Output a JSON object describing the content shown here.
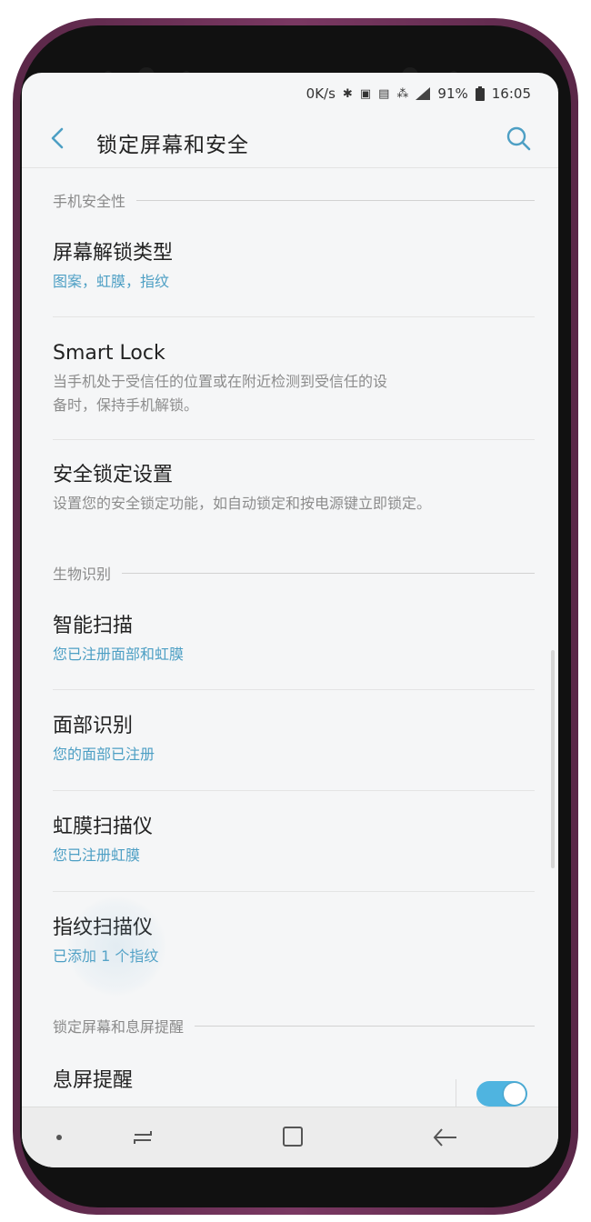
{
  "status_bar": {
    "speed": "0K/s",
    "icons": [
      "bluetooth-icon",
      "nfc-icon",
      "vibrate-icon",
      "network-icon",
      "signal-icon"
    ],
    "battery": "91%",
    "time": "16:05"
  },
  "header": {
    "title": "锁定屏幕和安全",
    "back_icon": "chevron-left-icon",
    "search_icon": "search-icon"
  },
  "sections": [
    {
      "header": "手机安全性",
      "items": [
        {
          "title": "屏幕解锁类型",
          "subtitle": "图案，虹膜，指纹"
        },
        {
          "title": "Smart Lock",
          "desc_line1": "当手机处于受信任的位置或在附近检测到受信任的设",
          "desc_line2": "备时，保持手机解锁。"
        },
        {
          "title": "安全锁定设置",
          "desc": "设置您的安全锁定功能，如自动锁定和按电源键立即锁定。"
        }
      ]
    },
    {
      "header": "生物识别",
      "items": [
        {
          "title": "智能扫描",
          "subtitle": "您已注册面部和虹膜"
        },
        {
          "title": "面部识别",
          "subtitle": "您的面部已注册"
        },
        {
          "title": "虹膜扫描仪",
          "subtitle": "您已注册虹膜"
        },
        {
          "title": "指纹扫描仪",
          "subtitle": "已添加 1 个指纹"
        }
      ]
    },
    {
      "header": "锁定屏幕和息屏提醒",
      "items": [
        {
          "title": "息屏提醒",
          "toggle_on": true
        }
      ]
    }
  ],
  "colors": {
    "accent": "#4d9fc4",
    "toggle": "#4fb4e0",
    "phone_frame": "#6d2f57"
  },
  "nav_bar": {
    "icons": [
      "dot-icon",
      "recent-apps-icon",
      "home-icon",
      "back-arrow-icon"
    ]
  }
}
